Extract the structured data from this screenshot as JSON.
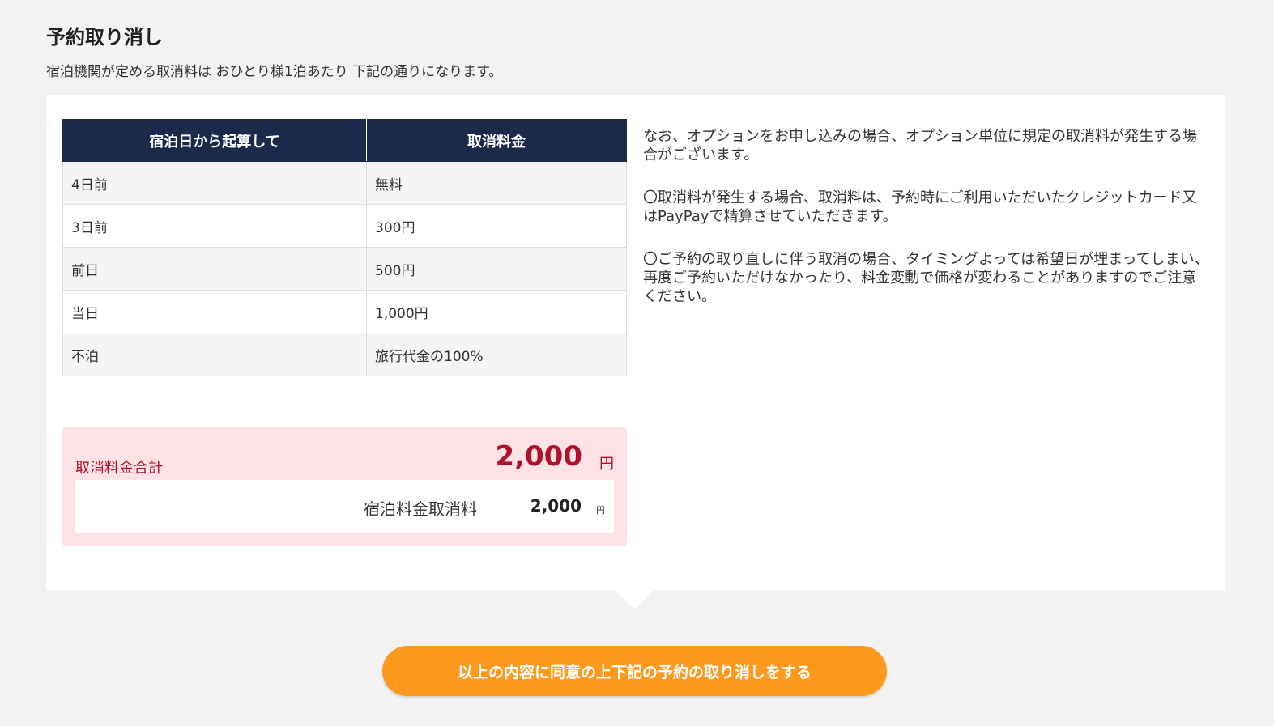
{
  "page": {
    "title": "予約取り消し",
    "description": "宿泊機関が定める取消料は おひとり様1泊あたり 下記の通りになります。"
  },
  "fee_table": {
    "headers": [
      "宿泊日から起算して",
      "取消料金"
    ],
    "rows": [
      [
        "4日前",
        "無料"
      ],
      [
        "3日前",
        "300円"
      ],
      [
        "前日",
        "500円"
      ],
      [
        "当日",
        "1,000円"
      ],
      [
        "不泊",
        "旅行代金の100%"
      ]
    ]
  },
  "notes": [
    "なお、オプションをお申し込みの場合、オプション単位に規定の取消料が発生する場合がございます。",
    "〇取消料が発生する場合、取消料は、予約時にご利用いただいたクレジットカード又はPayPayで精算させていただきます。",
    "〇ご予約の取り直しに伴う取消の場合、タイミングよっては希望日が埋まってしまい、再度ご予約いただけなかったり、料金変動で価格が変わることがありますのでご注意ください。"
  ],
  "total": {
    "label": "取消料金合計",
    "amount": "2,000",
    "unit": "円",
    "breakdown": {
      "label": "宿泊料金取消料",
      "amount": "2,000",
      "unit": "円"
    }
  },
  "confirm_button": {
    "label": "以上の内容に同意の上下記の予約の取り消しをする"
  },
  "colors": {
    "header_bg": "#1b2a4a",
    "accent_red": "#b0102a",
    "total_bg": "#fde3e6",
    "button_orange": "#fd9a1e"
  }
}
